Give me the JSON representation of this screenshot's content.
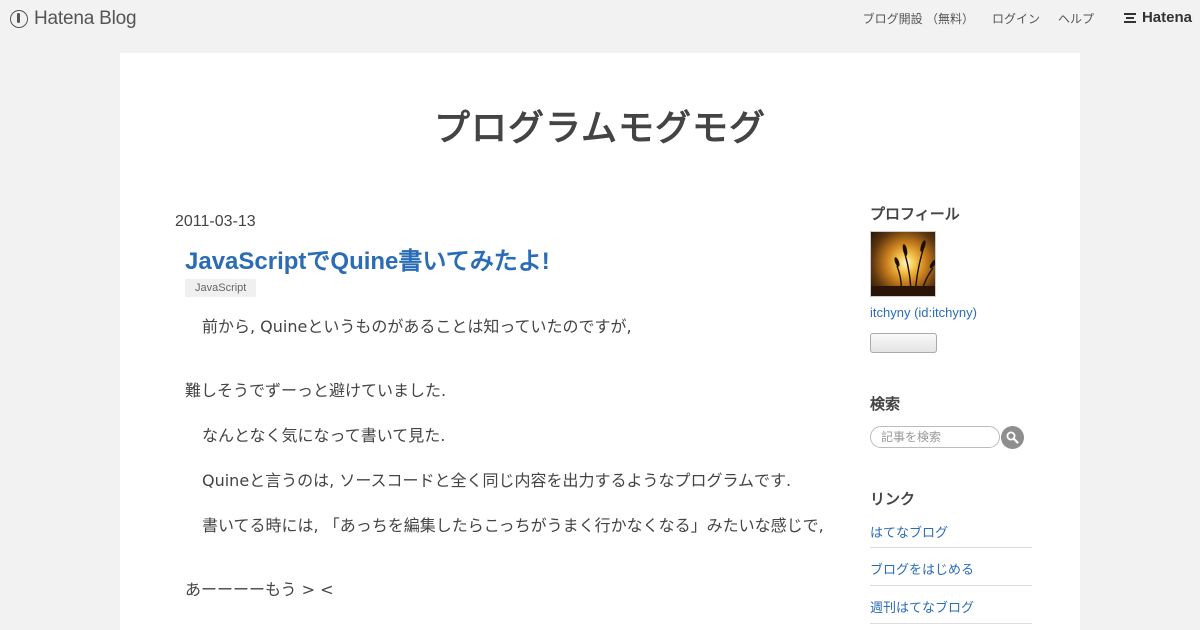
{
  "globalheader": {
    "logo_text": "Hatena Blog",
    "nav": [
      {
        "label": "ブログ開設 （無料）"
      },
      {
        "label": "ログイン"
      },
      {
        "label": "ヘルプ"
      }
    ],
    "brand": "Hatena"
  },
  "blog": {
    "title": "プログラムモグモグ"
  },
  "entry": {
    "date": "2011-03-13",
    "title": "JavaScriptでQuine書いてみたよ!",
    "category": "JavaScript",
    "paragraphs": [
      "前から, Quineというものがあることは知っていたのですが,",
      "難しそうでずーっと避けていました.",
      "なんとなく気になって書いて見た.",
      "Quineと言うのは, ソースコードと全く同じ内容を出力するようなプログラムです.",
      "書いてる時には, 「あっちを編集したらこっちがうまく行かなくなる」みたいな感じで,",
      "あーーーーもう > <"
    ]
  },
  "sidebar": {
    "profile_title": "プロフィール",
    "profile_name": "itchyny (id:itchyny)",
    "search_title": "検索",
    "search_placeholder": "記事を検索",
    "links_title": "リンク",
    "links": [
      {
        "label": "はてなブログ"
      },
      {
        "label": "ブログをはじめる"
      },
      {
        "label": "週刊はてなブログ"
      }
    ]
  },
  "colors": {
    "link": "#2a6cb5",
    "page_background": "#f2f2f2",
    "content_background": "#ffffff"
  }
}
